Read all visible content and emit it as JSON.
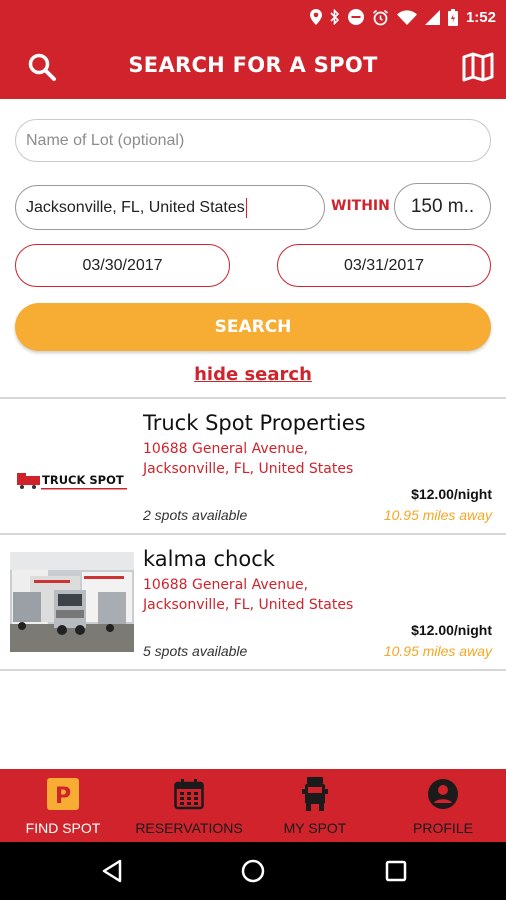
{
  "status_bar": {
    "time": "1:52"
  },
  "app_bar": {
    "title": "SEARCH FOR A SPOT"
  },
  "search": {
    "lot_placeholder": "Name of Lot (optional)",
    "location_value": "Jacksonville, FL, United States",
    "within_label": "WITHIN",
    "radius_value": "150 m..",
    "start_date": "03/30/2017",
    "end_date": "03/31/2017",
    "search_label": "SEARCH",
    "hide_label": "hide search"
  },
  "results": [
    {
      "name": "Truck Spot Properties",
      "address_line1": "10688 General Avenue,",
      "address_line2": "Jacksonville, FL, United States",
      "price": "$12.00/night",
      "availability": "2 spots available",
      "distance": "10.95 miles away",
      "logo_text": "TRUCK SPOT"
    },
    {
      "name": "kalma chock",
      "address_line1": "10688 General Avenue,",
      "address_line2": "Jacksonville, FL, United States",
      "price": "$12.00/night",
      "availability": "5 spots available",
      "distance": "10.95 miles away"
    }
  ],
  "bottom_nav": [
    {
      "label": "FIND SPOT",
      "icon": "parking-icon",
      "active": true
    },
    {
      "label": "RESERVATIONS",
      "icon": "calendar-icon",
      "active": false
    },
    {
      "label": "MY SPOT",
      "icon": "truck-icon",
      "active": false
    },
    {
      "label": "PROFILE",
      "icon": "profile-icon",
      "active": false
    }
  ],
  "colors": {
    "brand_red": "#d0232c",
    "accent_orange": "#f7ac33",
    "distance_orange": "#f5a623"
  }
}
